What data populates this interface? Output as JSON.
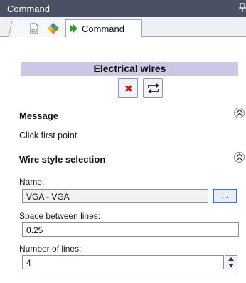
{
  "window": {
    "title": "Command"
  },
  "tabs": [
    {
      "icon": "document-icon"
    },
    {
      "icon": "diamond-puzzle-icon"
    },
    {
      "icon": "play-icon",
      "label": "Command"
    }
  ],
  "command_panel": {
    "header": "Electrical wires",
    "buttons": [
      {
        "icon": "delete-x-icon",
        "color": "#d01717"
      },
      {
        "icon": "swap-arrows-icon"
      }
    ],
    "message_group": {
      "title": "Message",
      "text": "Click first point"
    },
    "wire_style_group": {
      "title": "Wire style selection",
      "name_label": "Name:",
      "name_value": "VGA - VGA",
      "browse_label": "...",
      "space_label": "Space between lines:",
      "space_value": "0.25",
      "lines_label": "Number of lines:",
      "lines_value": "4"
    }
  },
  "colors": {
    "titlebar": "#4a5163",
    "section_header": "#cdc7e6",
    "accent_border": "#3b76c7",
    "play_icon": "#2e9b2e"
  }
}
